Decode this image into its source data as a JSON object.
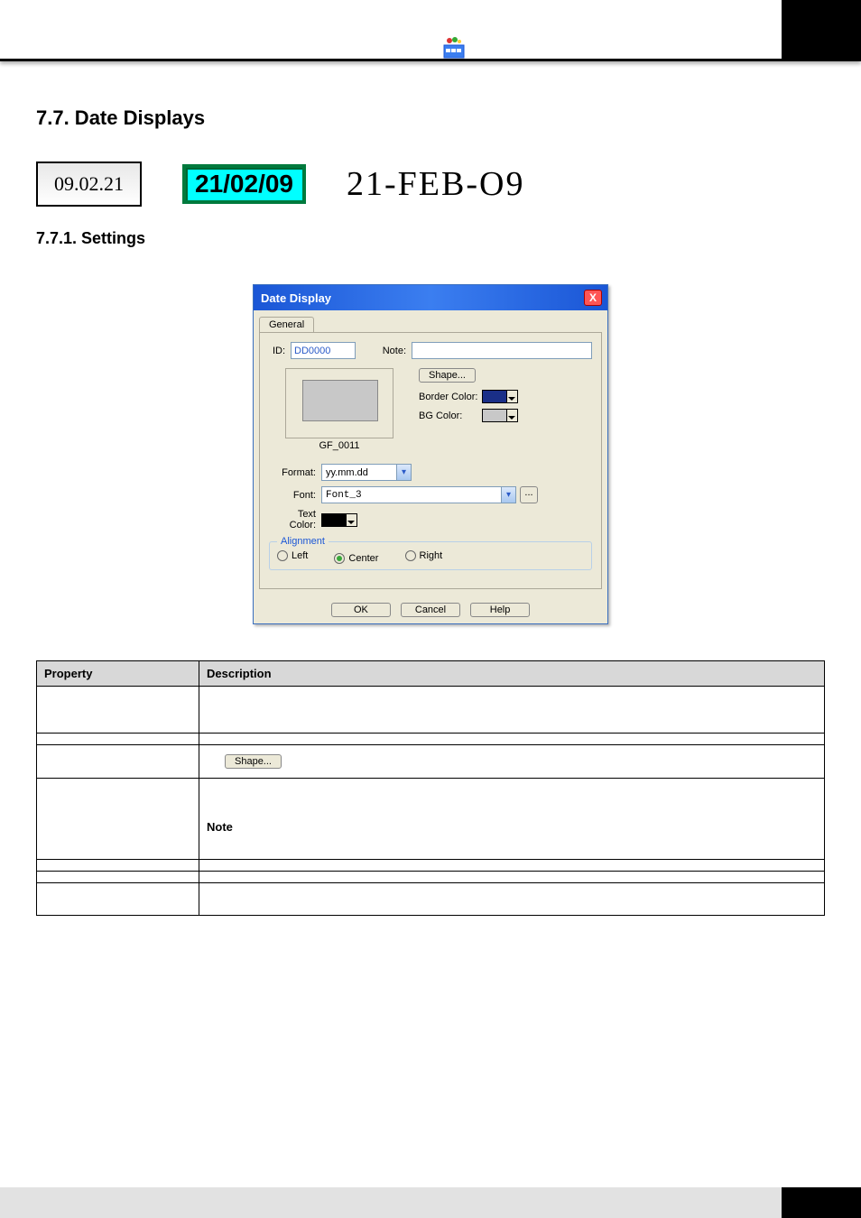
{
  "section_heading": "7.7. Date Displays",
  "subsection_heading": "7.7.1. Settings",
  "date_samples": {
    "style1": "09.02.21",
    "style2": "21/02/09",
    "style3": "21-FEB-O9"
  },
  "dialog": {
    "title": "Date Display",
    "tab": "General",
    "id_label": "ID:",
    "id_value": "DD0000",
    "note_label": "Note:",
    "note_value": "",
    "shape_button": "Shape...",
    "preview_caption": "GF_0011",
    "border_color_label": "Border Color:",
    "border_color": "#1a2f88",
    "bg_color_label": "BG Color:",
    "bg_color": "#c8c8c8",
    "format_label": "Format:",
    "format_value": "yy.mm.dd",
    "font_label": "Font:",
    "font_value": "Font_3",
    "text_color_label": "Text Color:",
    "text_color": "#000000",
    "alignment_legend": "Alignment",
    "align_left": "Left",
    "align_center": "Center",
    "align_right": "Right",
    "align_selected": "Center",
    "ok": "OK",
    "cancel": "Cancel",
    "help": "Help"
  },
  "table": {
    "header_property": "Property",
    "header_description": "Description",
    "rows": [
      {
        "property": "",
        "description": ""
      },
      {
        "property": "",
        "description": ""
      },
      {
        "property": "",
        "description_shape_btn": "Shape..."
      },
      {
        "property": "",
        "description_note_label": "Note"
      },
      {
        "property": "",
        "description": ""
      },
      {
        "property": "",
        "description": ""
      },
      {
        "property": "",
        "description": ""
      }
    ]
  }
}
